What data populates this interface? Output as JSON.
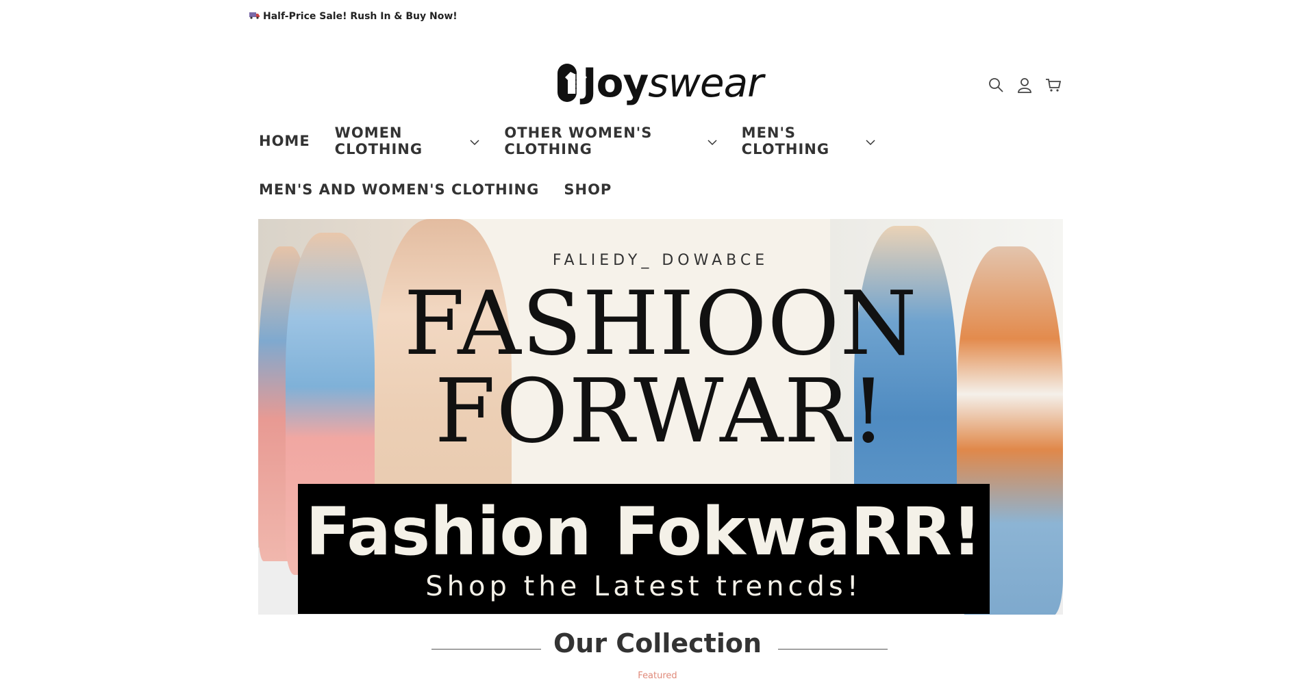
{
  "announcement": {
    "text": "Half-Price Sale! Rush In & Buy Now!",
    "icon": "truck-icon"
  },
  "brand": {
    "name_part1": "Joy",
    "name_part2": "swear"
  },
  "header_icons": {
    "search": "search-icon",
    "account": "user-icon",
    "cart": "cart-icon"
  },
  "nav": {
    "row1": [
      {
        "label": "HOME",
        "has_dropdown": false
      },
      {
        "label": "WOMEN CLOTHING",
        "has_dropdown": true
      },
      {
        "label": "OTHER WOMEN'S CLOTHING",
        "has_dropdown": true
      },
      {
        "label": "MEN'S CLOTHING",
        "has_dropdown": true
      }
    ],
    "row2": [
      {
        "label": "MEN'S AND WOMEN'S CLOTHING",
        "has_dropdown": false
      },
      {
        "label": "SHOP",
        "has_dropdown": false
      }
    ]
  },
  "hero": {
    "brand_line": "FALIEDY_   DOWABCE",
    "headline_line1": "FASHIOON",
    "headline_line2": "FORWAR!",
    "banner_title": "Fashion FokwaRR!",
    "banner_subtitle": "Shop the Latest trencds!"
  },
  "collection": {
    "title": "Our Collection",
    "subtitle": "Featured"
  },
  "colors": {
    "accent_subtitle": "#e08a7a",
    "text_dark": "#333333",
    "banner_bg": "#000000"
  }
}
